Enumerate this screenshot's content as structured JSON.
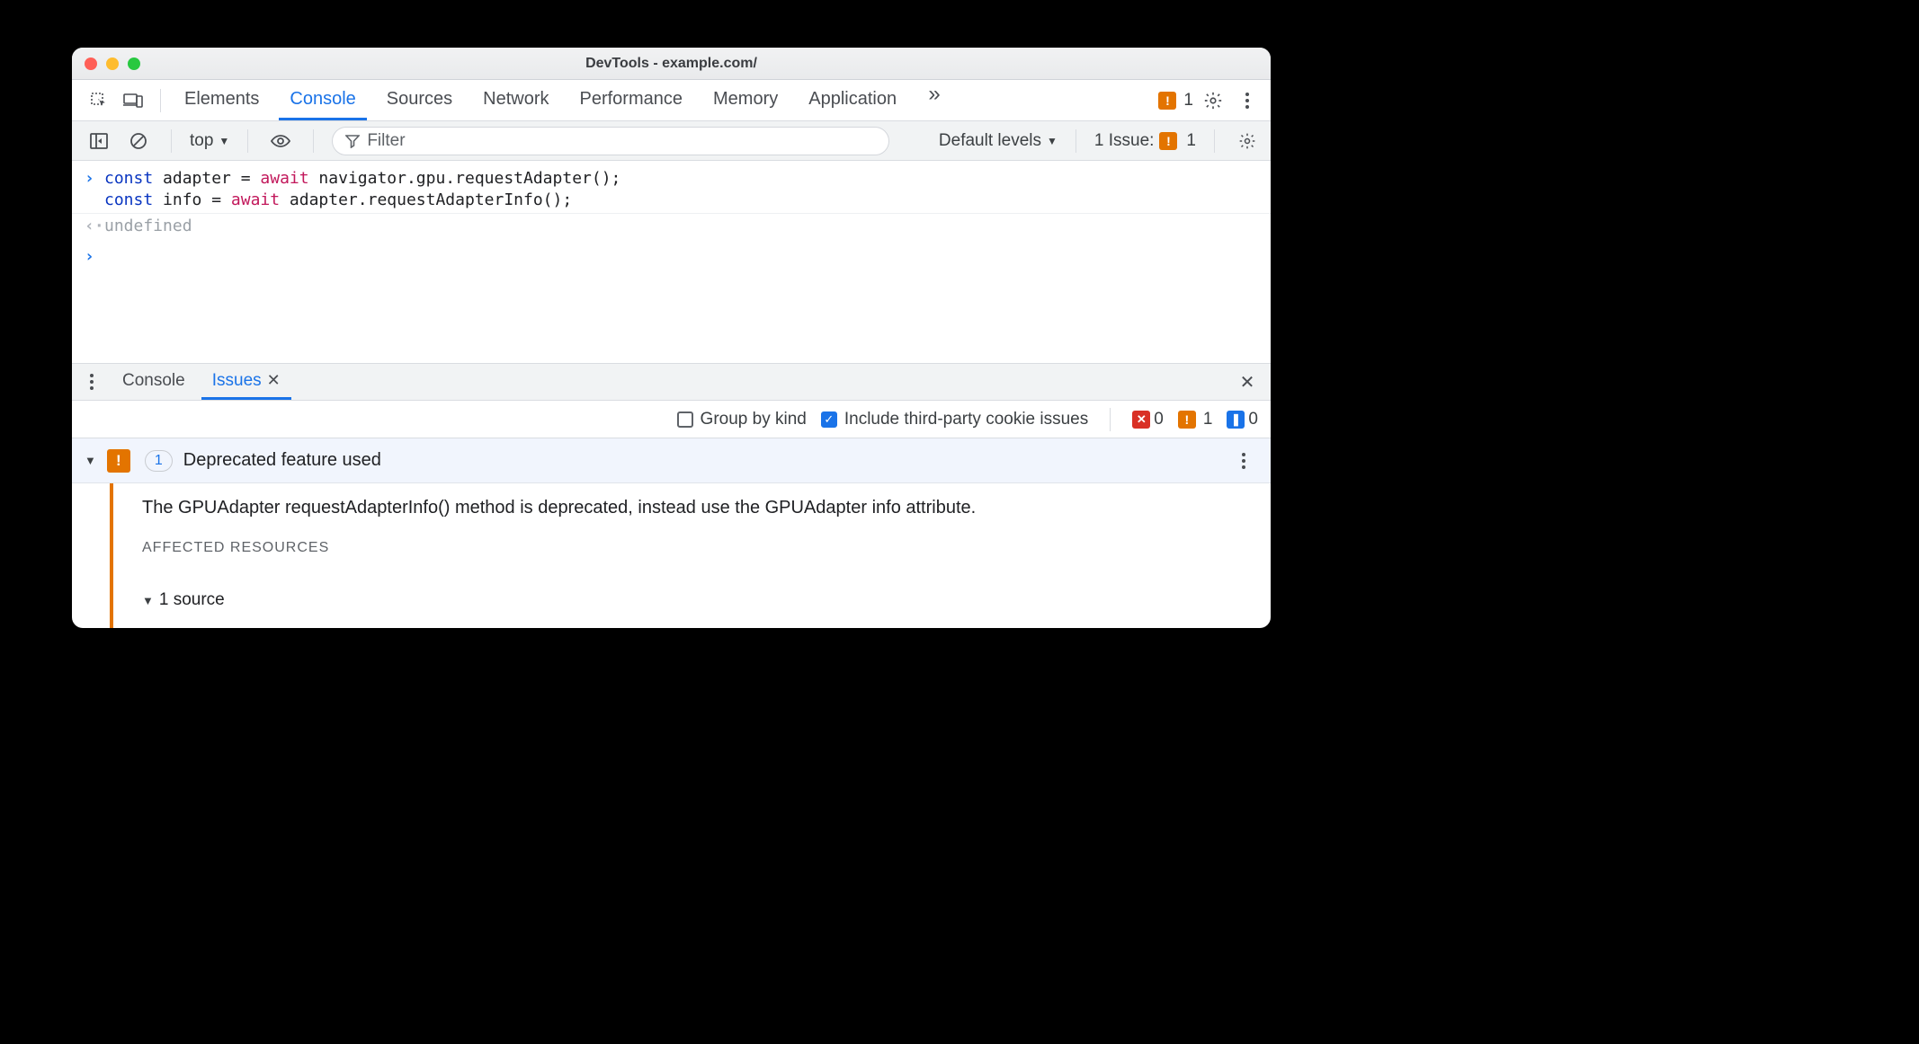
{
  "window": {
    "title": "DevTools - example.com/"
  },
  "tabs": {
    "items": [
      "Elements",
      "Console",
      "Sources",
      "Network",
      "Performance",
      "Memory",
      "Application"
    ],
    "active": "Console",
    "overflow_badge_count": "1"
  },
  "consolebar": {
    "context": "top",
    "filter_placeholder": "Filter",
    "levels": "Default levels",
    "issues_label": "1 Issue:",
    "issues_count": "1"
  },
  "console": {
    "line1_leading": "const",
    "line1_var": " adapter = ",
    "line1_await": "await",
    "line1_tail": " navigator.gpu.requestAdapter();",
    "line2_leading": "const",
    "line2_var": " info = ",
    "line2_await": "await",
    "line2_tail": " adapter.requestAdapterInfo();",
    "return_value": "undefined"
  },
  "drawer": {
    "tabs": [
      "Console",
      "Issues"
    ],
    "active": "Issues",
    "group_by_kind": "Group by kind",
    "third_party": "Include third-party cookie issues",
    "counts": {
      "error": "0",
      "warn": "1",
      "info": "0"
    }
  },
  "issue": {
    "count_badge": "1",
    "title": "Deprecated feature used",
    "message": "The GPUAdapter requestAdapterInfo() method is deprecated, instead use the GPUAdapter info attribute.",
    "affected_resources_label": "AFFECTED RESOURCES",
    "source_line": "1 source"
  }
}
